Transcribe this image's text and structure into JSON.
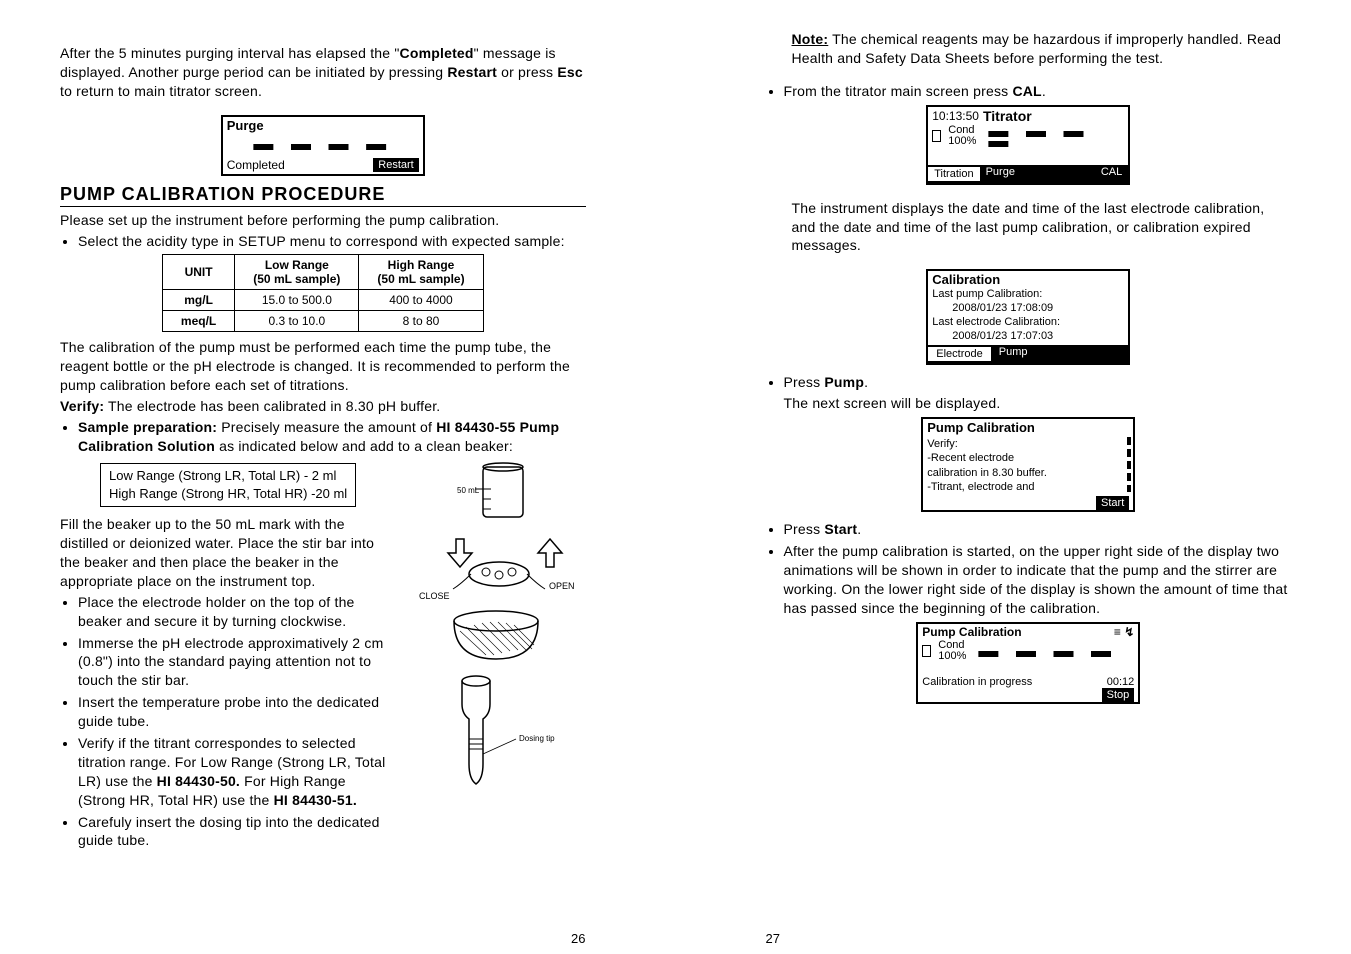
{
  "left": {
    "intro": "After the 5 minutes purging interval has elapsed the \"",
    "completed_word": "Completed",
    "intro_tail": "\" message is displayed. Another purge period can be initiated by pressing ",
    "restart_word": "Restart",
    "intro_mid": " or press ",
    "esc_word": "Esc",
    "intro_end": " to return to main titrator screen.",
    "lcd_purge": {
      "title": "Purge",
      "status": "Completed",
      "button": "Restart"
    },
    "heading": "PUMP  CALIBRATION  PROCEDURE",
    "setup_line": "Please set up the instrument before performing the pump calibration.",
    "bullet_setup": "Select the acidity type in SETUP menu to correspond with expected sample:",
    "table": {
      "h1": "UNIT",
      "h2_a": "Low Range",
      "h2_b": "(50 mL sample)",
      "h3_a": "High Range",
      "h3_b": "(50 mL sample)",
      "r1c1": "mg/L",
      "r1c2": "15.0 to 500.0",
      "r1c3": "400 to 4000",
      "r2c1": "meq/L",
      "r2c2": "0.3 to 10.0",
      "r2c3": "8 to 80"
    },
    "cal_para": "The calibration of the pump must be performed each time the pump tube, the reagent bottle or the pH electrode is changed. It is recommended to perform the pump calibration before each set of titrations.",
    "verify_label": "Verify:",
    "verify_text": " The electrode has been calibrated in 8.30 pH buffer.",
    "sample_prep_label": "Sample preparation:",
    "sample_prep_text": " Precisely measure the amount of ",
    "sample_prep_bold": "HI 84430-55 Pump Calibration Solution",
    "sample_prep_tail": " as indicated below and add to a clean beaker:",
    "prep_box_l1": "Low Range (Strong LR, Total  LR) - 2 ml",
    "prep_box_l2": "High Range (Strong HR, Total HR) -20 ml",
    "fill_para": "Fill the beaker up to the 50 mL mark with the distilled or deionized water. Place the stir bar into the beaker and then place the beaker in the appropriate place on the instrument top.",
    "b_place": "Place the electrode holder on the top of the beaker and secure it by turning clockwise.",
    "b_immerse": "Immerse the pH electrode approximatively 2 cm (0.8\") into the standard paying attention not to touch the stir bar.",
    "b_insert": "Insert the temperature probe into the dedicated guide tube.",
    "b_verify1": "Verify if the titrant correspondes to selected titration range. For Low Range (Strong LR, Total LR) use the ",
    "b_verify_b1": "HI 84430-50.",
    "b_verify2": " For High Range (Strong HR, Total HR) use the ",
    "b_verify_b2": "HI 84430-51.",
    "b_careful": "Carefuly insert the dosing tip into the dedicated guide tube.",
    "label_50ml": "50 mL",
    "label_close": "CLOSE",
    "label_open": "OPEN",
    "label_dosing": "Dosing tip",
    "page_num": "26"
  },
  "right": {
    "note_label": "Note:",
    "note_text": " The chemical reagents may be hazardous if improperly handled. Read Health and Safety Data Sheets before performing the test.",
    "b_from": "From the titrator main screen press ",
    "b_from_bold": "CAL",
    "b_from_tail": ".",
    "lcd1": {
      "time": "10:13:50",
      "title": "Titrator",
      "cond": "Cond",
      "pct": "100%",
      "bar1": "Titration",
      "bar2": "Purge",
      "bar3": "CAL"
    },
    "para_after_lcd1": "The instrument displays the date and time of the last electrode calibration, and the date and time of the last pump calibration, or calibration expired messages.",
    "lcd2": {
      "title": "Calibration",
      "l1": "Last pump Calibration:",
      "l2": "2008/01/23  17:08:09",
      "l3": "Last electrode Calibration:",
      "l4": "2008/01/23  17:07:03",
      "bar1": "Electrode",
      "bar2": "Pump"
    },
    "b_press_pump_pre": "Press ",
    "b_press_pump": "Pump",
    "b_press_pump_tail": ".",
    "next_screen": "The next screen will be displayed.",
    "lcd3": {
      "title": "Pump Calibration",
      "l1": "Verify:",
      "l2": " -Recent electrode",
      "l3": "calibration in 8.30 buffer.",
      "l4": " -Titrant, electrode and",
      "btn": "Start"
    },
    "b_press_start_pre": "Press ",
    "b_press_start": "Start",
    "b_press_start_tail": ".",
    "b_after": "After the pump calibration is started, on the upper right side of the display two animations will be shown in order to indicate that the pump and the stirrer are working. On the lower right side of the display is shown the amount of time that has passed since the beginning of the calibration.",
    "lcd4": {
      "title": "Pump Calibration",
      "anim": "≡ ↯",
      "cond": "Cond",
      "pct": "100%",
      "progress": "Calibration in progress",
      "time": "00:12",
      "btn": "Stop"
    },
    "page_num": "27"
  }
}
